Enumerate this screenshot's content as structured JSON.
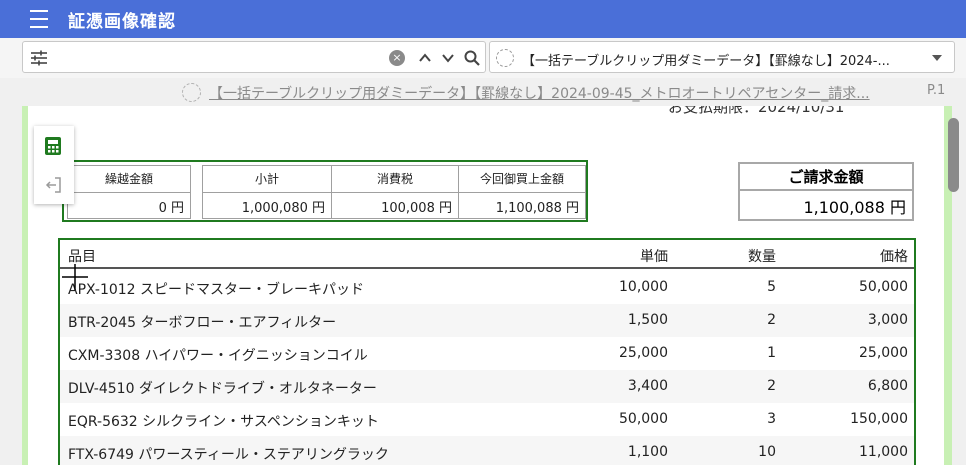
{
  "app": {
    "title": "証憑画像確認"
  },
  "search": {
    "placeholder": "",
    "value": "",
    "clear_glyph": "×"
  },
  "doc_select": {
    "value": "【一括テーブルクリップ用ダミーデータ】【罫線なし】2024-..."
  },
  "document": {
    "link_text": "【一括テーブルクリップ用ダミーデータ】【罫線なし】2024-09-45_メトロオートリペアセンター_請求...",
    "page": "P.1",
    "due_text": "お支払期限：2024/10/31"
  },
  "summary": {
    "cells": [
      {
        "label": "繰越金額",
        "value": "0 円"
      },
      {
        "label": "小計",
        "value": "1,000,080 円"
      },
      {
        "label": "消費税",
        "value": "100,008 円"
      },
      {
        "label": "今回御買上金額",
        "value": "1,100,088 円"
      }
    ]
  },
  "grand_total": {
    "label": "ご請求金額",
    "value": "1,100,088 円"
  },
  "items_table": {
    "headers": [
      "品目",
      "単価",
      "数量",
      "価格"
    ],
    "rows": [
      [
        "APX-1012 スピードマスター・ブレーキパッド",
        "10,000",
        "5",
        "50,000"
      ],
      [
        "BTR-2045 ターボフロー・エアフィルター",
        "1,500",
        "2",
        "3,000"
      ],
      [
        "CXM-3308 ハイパワー・イグニッションコイル",
        "25,000",
        "1",
        "25,000"
      ],
      [
        "DLV-4510 ダイレクトドライブ・オルタネーター",
        "3,400",
        "2",
        "6,800"
      ],
      [
        "EQR-5632 シルクライン・サスペンションキット",
        "50,000",
        "3",
        "150,000"
      ],
      [
        "FTX-6749 パワースティール・ステアリングラック",
        "1,100",
        "10",
        "11,000"
      ]
    ]
  },
  "icons": {
    "menu": "menu-icon",
    "filter": "filter-icon",
    "clear": "clear-icon",
    "up": "chevron-up-icon",
    "down": "chevron-down-icon",
    "search": "search-icon",
    "loading": "loading-icon",
    "calculator": "calculator-icon",
    "exit": "exit-icon"
  },
  "colors": {
    "titlebar": "#4a6fd8",
    "highlight_border": "#1f7a1f",
    "viewer_bg": "#c8f0b4",
    "calculator_icon": "#1f7a1f"
  }
}
